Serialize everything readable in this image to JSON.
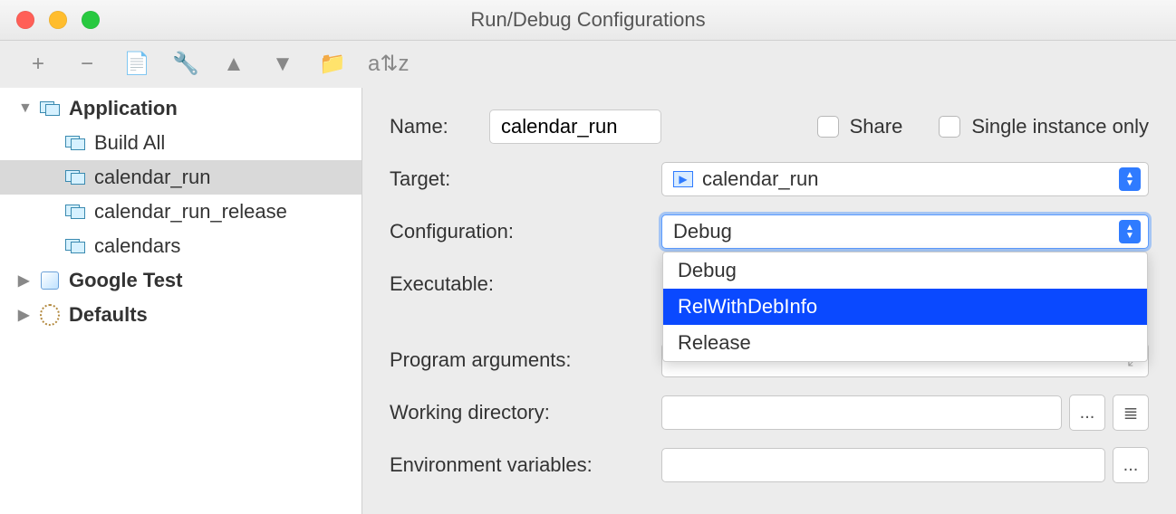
{
  "window": {
    "title": "Run/Debug Configurations"
  },
  "toolbar": {
    "add": "+",
    "remove": "−",
    "copy": "📄",
    "wrench": "🔧",
    "up": "▲",
    "down": "▼",
    "folder": "📁",
    "sort": "a⇅z"
  },
  "tree": {
    "application": {
      "label": "Application",
      "items": [
        "Build All",
        "calendar_run",
        "calendar_run_release",
        "calendars"
      ]
    },
    "googletest": "Google Test",
    "defaults": "Defaults"
  },
  "form": {
    "name_label": "Name:",
    "name_value": "calendar_run",
    "share": "Share",
    "single": "Single instance only",
    "target_label": "Target:",
    "target_value": "calendar_run",
    "config_label": "Configuration:",
    "config_value": "Debug",
    "config_options": [
      "Debug",
      "RelWithDebInfo",
      "Release"
    ],
    "config_highlight": "RelWithDebInfo",
    "exec_label": "Executable:",
    "args_label": "Program arguments:",
    "wd_label": "Working directory:",
    "env_label": "Environment variables:",
    "dots": "...",
    "list": "≣",
    "expand": "⤢"
  }
}
